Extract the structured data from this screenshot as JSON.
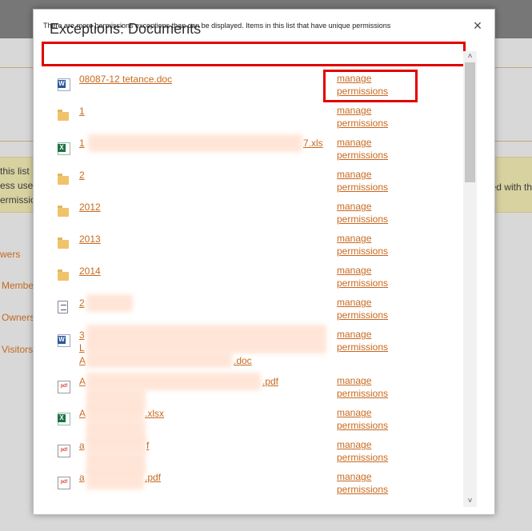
{
  "background": {
    "banner_left_lines": [
      "this list",
      "ess use",
      "ermission"
    ],
    "banner_right": "ed with th",
    "nav": [
      "wers",
      "Member",
      "Owners",
      "Visitors"
    ]
  },
  "dialog": {
    "title": "Exceptions: Documents",
    "close_label": "×",
    "notice": "There are more permissions exceptions than can be displayed. Items in this list that have unique permissions"
  },
  "manage_label_line1": "manage",
  "manage_label_line2": "permissions",
  "items": [
    {
      "icon": "word-document-icon",
      "name": "08087-12 tetance.doc"
    },
    {
      "icon": "folder-icon",
      "name": "1"
    },
    {
      "icon": "excel-document-icon",
      "name": "1",
      "suffix": "7.xls"
    },
    {
      "icon": "folder-icon",
      "name": "2"
    },
    {
      "icon": "folder-icon",
      "name": "2012"
    },
    {
      "icon": "folder-icon",
      "name": "2013"
    },
    {
      "icon": "folder-icon",
      "name": "2014"
    },
    {
      "icon": "text-document-icon",
      "name": "2"
    },
    {
      "icon": "word-document-icon",
      "name": "3",
      "line2": "L",
      "line3": "A",
      "suffix": ".doc"
    },
    {
      "icon": "pdf-document-icon",
      "name": "A",
      "suffix": ".pdf"
    },
    {
      "icon": "excel-document-icon",
      "name": "A",
      "suffix": ".xlsx"
    },
    {
      "icon": "pdf-document-icon",
      "name": "a",
      "suffix": "f"
    },
    {
      "icon": "pdf-document-icon",
      "name": "a",
      "suffix": ".pdf"
    }
  ],
  "colors": {
    "accent": "#c8691f",
    "highlight": "#e10000"
  }
}
